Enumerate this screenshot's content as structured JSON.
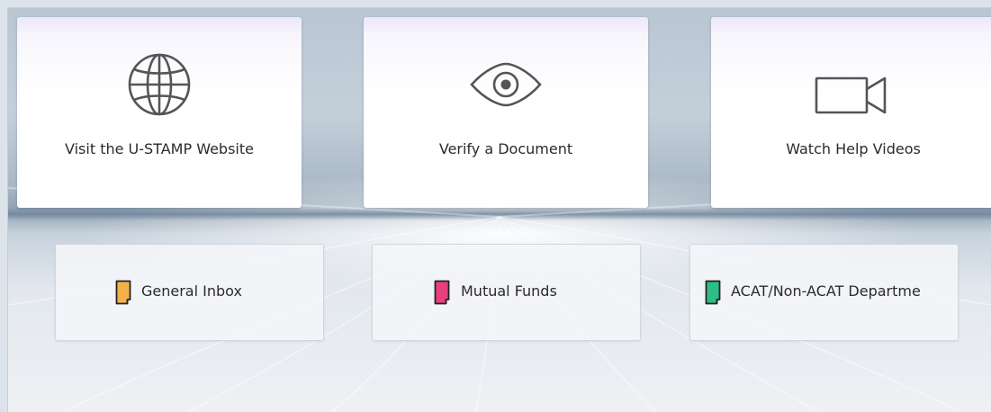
{
  "action_tiles": [
    {
      "label": "Visit the U-STAMP Website",
      "icon": "globe-icon"
    },
    {
      "label": "Verify a Document",
      "icon": "eye-icon"
    },
    {
      "label": "Watch Help Videos",
      "icon": "video-camera-icon"
    }
  ],
  "inbox_tiles": [
    {
      "label": "General Inbox",
      "icon": "document-icon",
      "color": "#f4b14a"
    },
    {
      "label": "Mutual Funds",
      "icon": "document-icon",
      "color": "#e8407f"
    },
    {
      "label": "ACAT/Non-ACAT Departme",
      "icon": "document-icon",
      "color": "#2dbd86"
    }
  ],
  "colors": {
    "icon_stroke": "#555555",
    "text": "#2b2b2b"
  }
}
